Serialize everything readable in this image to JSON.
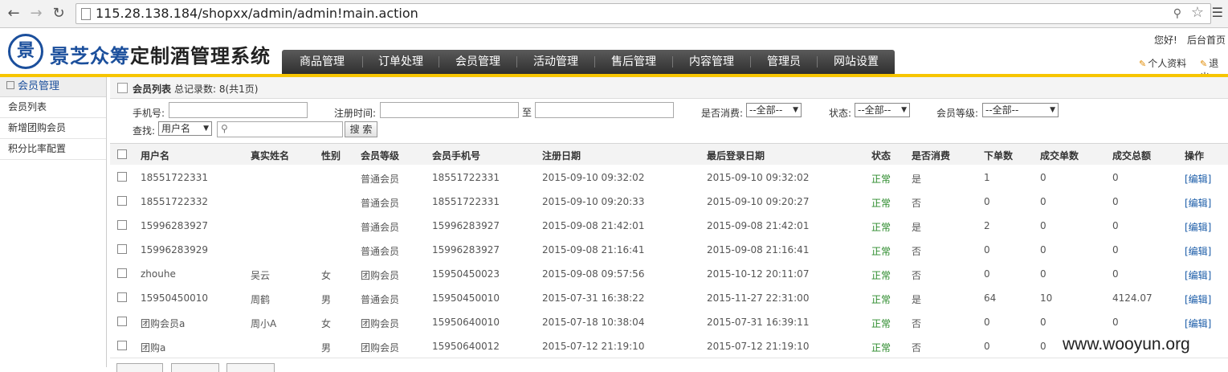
{
  "browser": {
    "url": "115.28.138.184/shopxx/admin/admin!main.action"
  },
  "header": {
    "brand_blue": "景芝众筹",
    "brand_dark": "定制酒管理系统",
    "nav": [
      "商品管理",
      "订单处理",
      "会员管理",
      "活动管理",
      "售后管理",
      "内容管理",
      "管理员",
      "网站设置"
    ],
    "greeting": "您好!",
    "home": "后台首页",
    "profile": "个人资料",
    "logout": "退出"
  },
  "sidebar": {
    "title": "会员管理",
    "items": [
      "会员列表",
      "新增团购会员",
      "积分比率配置"
    ]
  },
  "main": {
    "title": "会员列表",
    "count": "总记录数: 8(共1页)"
  },
  "filters": {
    "phone_label": "手机号:",
    "reg_label": "注册时间:",
    "to_label": "至",
    "consume_label": "是否消费:",
    "consume_value": "--全部--",
    "status_label": "状态:",
    "status_value": "--全部--",
    "level_label": "会员等级:",
    "level_value": "--全部--",
    "search_label": "查找:",
    "search_field": "用户名",
    "search_button": "搜 索"
  },
  "table": {
    "headers": [
      "用户名",
      "真实姓名",
      "性别",
      "会员等级",
      "会员手机号",
      "注册日期",
      "最后登录日期",
      "状态",
      "是否消费",
      "下单数",
      "成交单数",
      "成交总额",
      "操作"
    ],
    "rows": [
      [
        "18551722331",
        "",
        "",
        "普通会员",
        "18551722331",
        "2015-09-10 09:32:02",
        "2015-09-10 09:32:02",
        "正常",
        "是",
        "1",
        "0",
        "0",
        "[编辑]"
      ],
      [
        "18551722332",
        "",
        "",
        "普通会员",
        "18551722331",
        "2015-09-10 09:20:33",
        "2015-09-10 09:20:27",
        "正常",
        "否",
        "0",
        "0",
        "0",
        "[编辑]"
      ],
      [
        "15996283927",
        "",
        "",
        "普通会员",
        "15996283927",
        "2015-09-08 21:42:01",
        "2015-09-08 21:42:01",
        "正常",
        "是",
        "2",
        "0",
        "0",
        "[编辑]"
      ],
      [
        "15996283929",
        "",
        "",
        "普通会员",
        "15996283927",
        "2015-09-08 21:16:41",
        "2015-09-08 21:16:41",
        "正常",
        "否",
        "0",
        "0",
        "0",
        "[编辑]"
      ],
      [
        "zhouhe",
        "吴云",
        "女",
        "团购会员",
        "15950450023",
        "2015-09-08 09:57:56",
        "2015-10-12 20:11:07",
        "正常",
        "否",
        "0",
        "0",
        "0",
        "[编辑]"
      ],
      [
        "15950450010",
        "周鹤",
        "男",
        "普通会员",
        "15950450010",
        "2015-07-31 16:38:22",
        "2015-11-27 22:31:00",
        "正常",
        "是",
        "64",
        "10",
        "4124.07",
        "[编辑]"
      ],
      [
        "团购会员a",
        "周小A",
        "女",
        "团购会员",
        "15950640010",
        "2015-07-18 10:38:04",
        "2015-07-31 16:39:11",
        "正常",
        "否",
        "0",
        "0",
        "0",
        "[编辑]"
      ],
      [
        "团购a",
        "",
        "男",
        "团购会员",
        "15950640012",
        "2015-07-12 21:19:10",
        "2015-07-12 21:19:10",
        "正常",
        "否",
        "0",
        "0",
        "",
        ""
      ]
    ]
  },
  "watermark": "www.wooyun.org",
  "colors": {
    "brand_blue": "#1b4f9c",
    "accent_yellow": "#f7c500",
    "status_green": "#2a8a2a",
    "link_blue": "#1b5ca8"
  }
}
